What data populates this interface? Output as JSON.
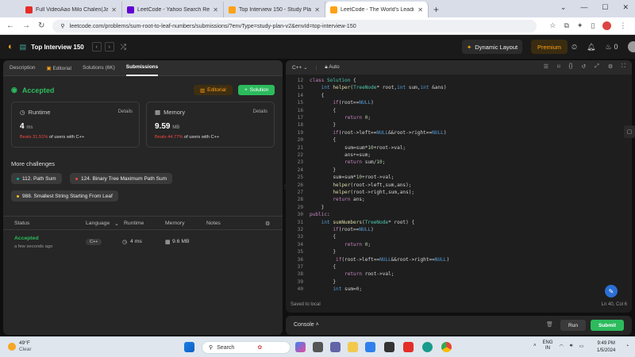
{
  "browser": {
    "tabs": [
      {
        "title": "Full VideoAao Milo Chalen(Ja...",
        "color": "#e52d27"
      },
      {
        "title": "LeetCode - Yahoo Search Resul...",
        "color": "#6001d2"
      },
      {
        "title": "Top Interview 150 - Study Plan...",
        "color": "#ffa116"
      },
      {
        "title": "LeetCode - The World's Leadin...",
        "color": "#ffa116"
      }
    ],
    "url": "leetcode.com/problems/sum-root-to-leaf-numbers/submissions/?envType=study-plan-v2&envId=top-interview-150"
  },
  "header": {
    "studyplan": "Top Interview 150",
    "dynamic_layout": "Dynamic Layout",
    "premium": "Premium",
    "streak": "0"
  },
  "left": {
    "tabs": [
      "Description",
      "Editorial",
      "Solutions (6K)",
      "Submissions"
    ],
    "status": "Accepted",
    "editorial_btn": "Editorial",
    "solution_btn": "Solution",
    "runtime": {
      "label": "Runtime",
      "details": "Details",
      "value": "4",
      "unit": "ms",
      "beats_pct": "Beats 31.51%",
      "beats_rest": "of users with C++"
    },
    "memory": {
      "label": "Memory",
      "details": "Details",
      "value": "9.59",
      "unit": "MB",
      "beats_pct": "Beats 44.77%",
      "beats_rest": "of users with C++"
    },
    "more_challenges": "More challenges",
    "challenges": [
      {
        "label": "112. Path Sum",
        "color": "#00b8a3"
      },
      {
        "label": "124. Binary Tree Maximum Path Sum",
        "color": "#ef4743"
      },
      {
        "label": "988. Smallest String Starting From Leaf",
        "color": "#ffc01e"
      }
    ],
    "table_headers": [
      "Status",
      "Language",
      "Runtime",
      "Memory",
      "Notes"
    ],
    "row": {
      "status": "Accepted",
      "time": "a few seconds ago",
      "language": "C++",
      "runtime": "4 ms",
      "memory": "9.6 MB"
    }
  },
  "editor": {
    "language": "C++",
    "mode": "Auto",
    "saved": "Saved to local",
    "position": "Ln 40, Col 6",
    "lines": [
      {
        "n": "12",
        "t": "class Solution {"
      },
      {
        "n": "13",
        "t": "    int helper(TreeNode* root,int sum,int &ans)"
      },
      {
        "n": "14",
        "t": "    {"
      },
      {
        "n": "15",
        "t": "        if(root==NULL)"
      },
      {
        "n": "16",
        "t": "        {"
      },
      {
        "n": "17",
        "t": "            return 0;"
      },
      {
        "n": "18",
        "t": "        }"
      },
      {
        "n": "19",
        "t": "        if(root->left==NULL&&root->right==NULL)"
      },
      {
        "n": "20",
        "t": "        {"
      },
      {
        "n": "21",
        "t": "            sum=sum*10+root->val;"
      },
      {
        "n": "22",
        "t": "            ans+=sum;"
      },
      {
        "n": "23",
        "t": "            return sum/10;"
      },
      {
        "n": "24",
        "t": "        }"
      },
      {
        "n": "25",
        "t": "        sum=sum*10+root->val;"
      },
      {
        "n": "26",
        "t": "        helper(root->left,sum,ans);"
      },
      {
        "n": "27",
        "t": "        helper(root->right,sum,ans);"
      },
      {
        "n": "28",
        "t": "        return ans;"
      },
      {
        "n": "29",
        "t": "    }"
      },
      {
        "n": "30",
        "t": "public:"
      },
      {
        "n": "31",
        "t": "    int sumNumbers(TreeNode* root) {"
      },
      {
        "n": "32",
        "t": "        if(root==NULL)"
      },
      {
        "n": "33",
        "t": "        {"
      },
      {
        "n": "34",
        "t": "            return 0;"
      },
      {
        "n": "35",
        "t": "        }"
      },
      {
        "n": "36",
        "t": "         if(root->left==NULL&&root->right==NULL)"
      },
      {
        "n": "37",
        "t": "        {"
      },
      {
        "n": "38",
        "t": "            return root->val;"
      },
      {
        "n": "39",
        "t": "        }"
      },
      {
        "n": "40",
        "t": "        int sum=0;"
      }
    ]
  },
  "console": {
    "label": "Console",
    "run": "Run",
    "submit": "Submit"
  },
  "taskbar": {
    "temp": "49°F",
    "weather": "Clear",
    "search": "Search",
    "lang_top": "ENG",
    "lang_bottom": "IN",
    "time": "9:49 PM",
    "date": "1/5/2024"
  }
}
